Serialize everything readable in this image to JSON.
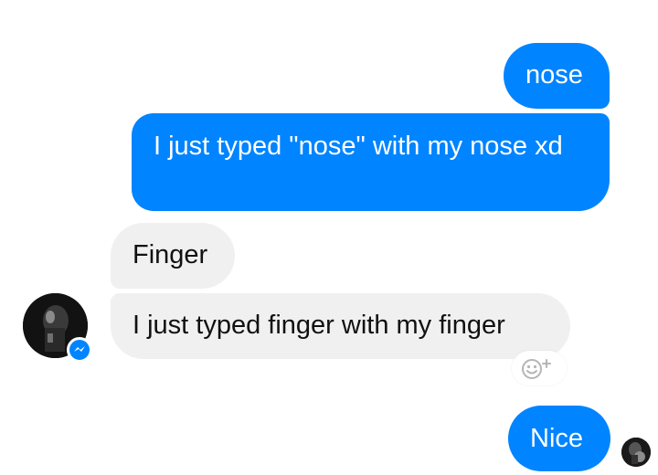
{
  "messages": [
    {
      "sender": "me",
      "text": "nose"
    },
    {
      "sender": "me",
      "text": "I just typed \"nose\" with my nose xd"
    },
    {
      "sender": "contact",
      "text": "Finger"
    },
    {
      "sender": "contact",
      "text": "I just typed finger with my finger"
    },
    {
      "sender": "me",
      "text": "Nice"
    }
  ],
  "icons": {
    "contact_avatar": "contact-avatar-photo",
    "messenger_badge": "messenger-bolt-icon",
    "reaction_button": "smiley-plus-icon",
    "seen_avatar": "seen-avatar-photo"
  },
  "colors": {
    "sent_bubble": "#0084ff",
    "received_bubble": "#f1f0f0",
    "background": "#ffffff"
  }
}
